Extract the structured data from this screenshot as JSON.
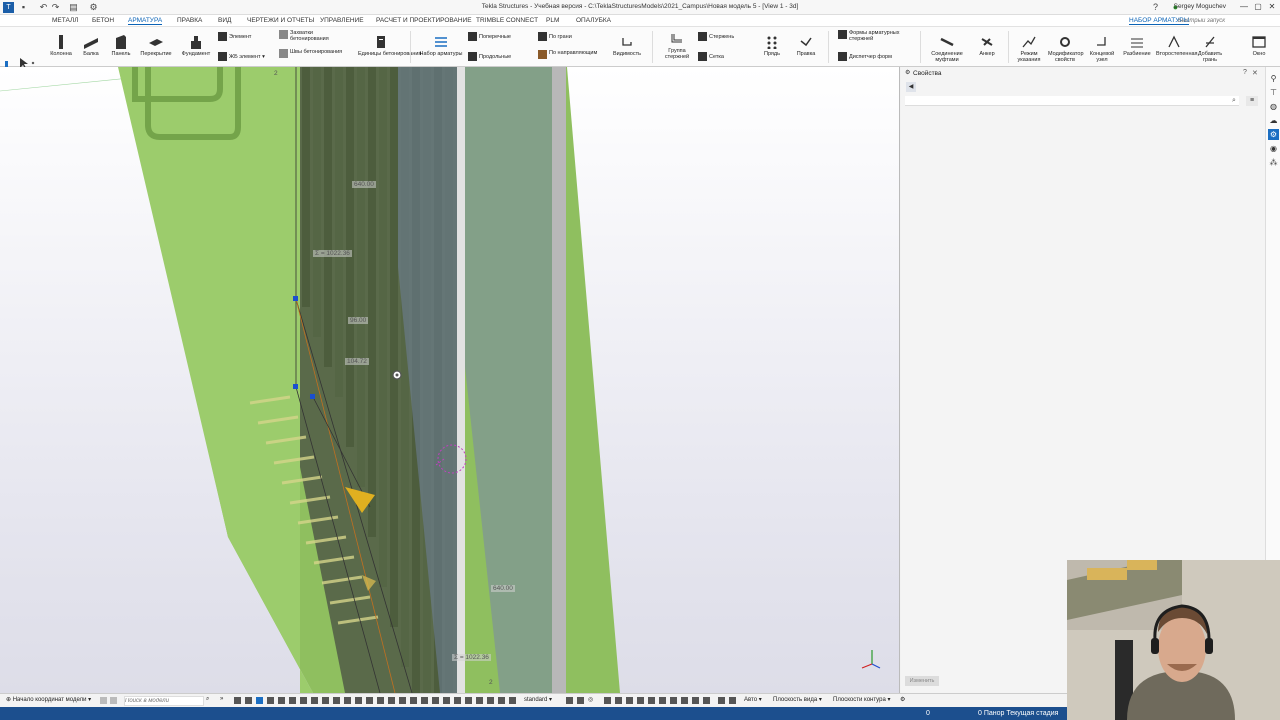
{
  "titlebar": {
    "title": "Tekla Structures - Учебная версия - C:\\TeklaStructuresModels\\2021_Campus\\Новая модель 5 - [View 1 - 3d]",
    "user": "Sergey Moguchev",
    "logo": "T"
  },
  "menu": {
    "tabs": [
      "МЕТАЛЛ",
      "БЕТОН",
      "АРМАТУРА",
      "ПРАВКА",
      "ВИД",
      "ЧЕРТЕЖИ И ОТЧЕТЫ",
      "УПРАВЛЕНИЕ",
      "РАСЧЕТ И ПРОЕКТИРОВАНИЕ",
      "TRIMBLE CONNECT",
      "PLM",
      "ОПАЛУБКА"
    ],
    "active_tab": "АРМАТУРА",
    "right_tab": "НАБОР АРМАТУРЫ",
    "quick_launch_placeholder": "Быстрый запуск"
  },
  "ribbon": {
    "kolonna": "Колонна",
    "balka": "Балка",
    "panel": "Панель",
    "perekrytie": "Перекрытие",
    "fundament": "Фундамент",
    "element": "Элемент",
    "zhb_element": "ЖБ элемент",
    "zakhvatki": "Захватки бетонирования",
    "shvy": "Швы бетонирования",
    "edinitsy": "Единицы бетонирования",
    "nabor_armatury": "Набор арматуры",
    "poperechnye": "Поперечные",
    "prodolnye": "Продольные",
    "po_grani": "По грани",
    "po_napravl": "По направляющим",
    "vidimost": "Видимость",
    "gruppa": "Группа стержней",
    "sterzhen": "Стержень",
    "setka": "Сетка",
    "pryad": "Прядь",
    "pravka": "Правка",
    "formy": "Формы арматурных стержней",
    "dispetcher": "Диспетчер форм",
    "soedinenie": "Соединение муфтами",
    "ankery": "Анкер",
    "rezhim": "Режим указания",
    "modifikator": "Модификатор свойств",
    "konechniy": "Концевой узел",
    "razbienie": "Разбиение",
    "vtorostepennaya": "Второстепенная",
    "dobavit": "Добавить грань",
    "okno": "Окно"
  },
  "viewport": {
    "grid_labels": [
      "2",
      "2"
    ],
    "dimensions": [
      "640.00",
      "Σ = 1022.36",
      "96.00",
      "104.72",
      "640.00",
      "Σ = 1022.36"
    ]
  },
  "properties": {
    "title": "Свойства",
    "apply_label": "Изменить"
  },
  "bottombar": {
    "origin": "Начало координат модели",
    "search_placeholder": "Поиск в модели",
    "standard": "standard",
    "auto": "Авто",
    "view_plane": "Плоскость вида",
    "contour_plane": "Плоскости контура"
  },
  "statusbar": {
    "left_count": "0",
    "status": "0  Панор  Текущая стадия"
  },
  "colors": {
    "accent": "#0b63b6",
    "status_bar": "#1c4f8e",
    "concrete_green": "#8fbf5f"
  }
}
